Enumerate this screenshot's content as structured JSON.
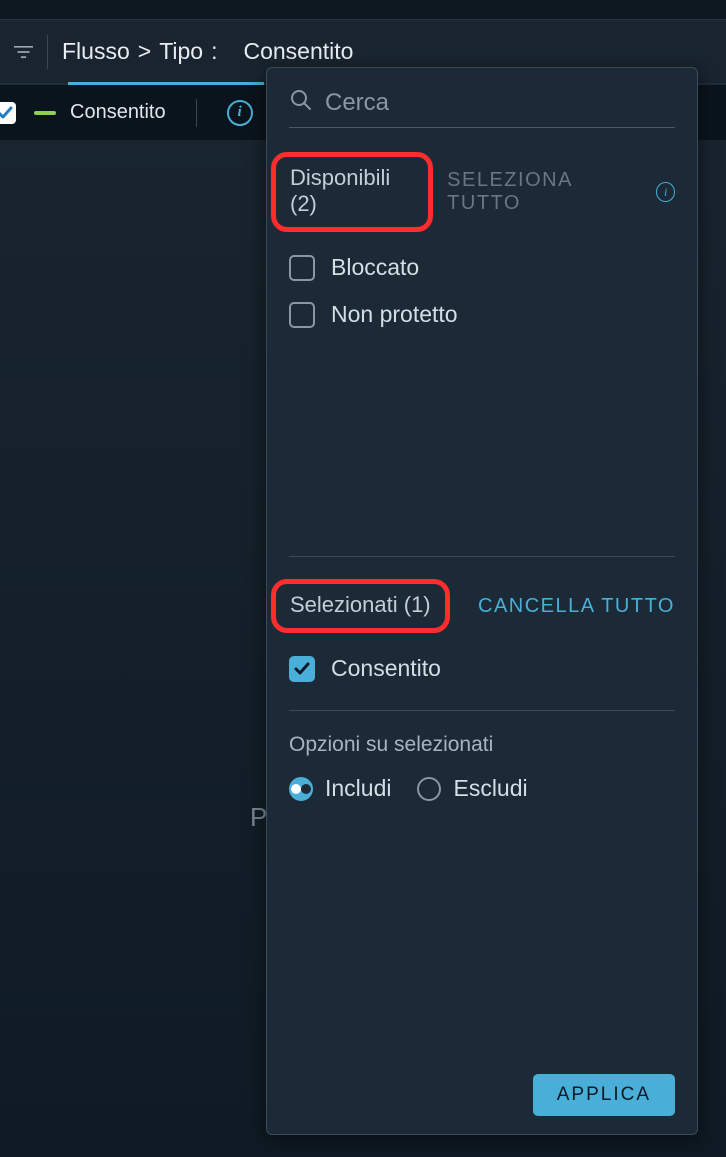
{
  "breadcrumb": {
    "path1": "Flusso",
    "sep1": ">",
    "path2": "Tipo",
    "colon": ":",
    "value": "Consentito"
  },
  "status_bar": {
    "label": "Consentito"
  },
  "dropdown": {
    "search_placeholder": "Cerca",
    "available": {
      "label": "Disponibili (2)",
      "select_all": "SELEZIONA TUTTO",
      "items": [
        {
          "label": "Bloccato",
          "checked": false
        },
        {
          "label": "Non protetto",
          "checked": false
        }
      ]
    },
    "selected": {
      "label": "Selezionati (1)",
      "clear_all": "CANCELLA TUTTO",
      "items": [
        {
          "label": "Consentito",
          "checked": true
        }
      ]
    },
    "options_on_selected": {
      "title": "Opzioni su selezionati",
      "include": "Includi",
      "exclude": "Escludi",
      "selected_option": "include"
    },
    "apply": "APPLICA"
  },
  "bg_letter": "P"
}
